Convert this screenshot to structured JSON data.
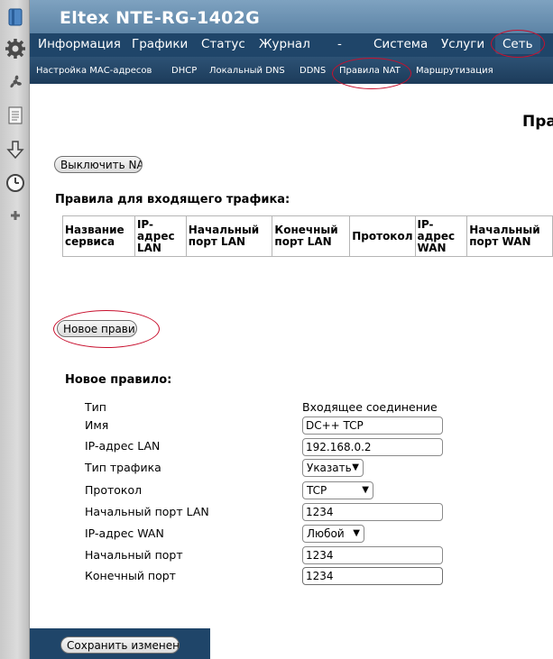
{
  "app": {
    "title": "Eltex NTE-RG-1402G"
  },
  "main_nav": [
    {
      "label": "Информация"
    },
    {
      "label": "Графики"
    },
    {
      "label": "Статус"
    },
    {
      "label": "Журнал"
    },
    {
      "label": "-"
    },
    {
      "label": "Система"
    },
    {
      "label": "Услуги"
    },
    {
      "label": "Сеть",
      "active": true
    }
  ],
  "sub_nav": [
    {
      "label": "Настройка МАС-адресов"
    },
    {
      "label": "DHCP"
    },
    {
      "label": "Локальный DNS"
    },
    {
      "label": "DDNS"
    },
    {
      "label": "Правила NAT",
      "active": true
    },
    {
      "label": "Маршрутизация"
    }
  ],
  "toolbar_icons": [
    "bookmark-icon",
    "gear-icon",
    "fan-icon",
    "notes-icon",
    "download-arrow-icon",
    "clock-icon",
    "plus-icon"
  ],
  "page": {
    "heading": "Пра",
    "disable_nat_button": "Выключить NAT",
    "incoming_title": "Правила для входящего трафика:",
    "table_headers": [
      {
        "label": "Название сервиса"
      },
      {
        "label": "IP-адрес LAN"
      },
      {
        "label": "Начальный порт LAN"
      },
      {
        "label": "Конечный порт LAN"
      },
      {
        "label": "Протокол"
      },
      {
        "label": "IP-адрес WAN"
      },
      {
        "label": "Начальный порт WAN"
      }
    ],
    "new_rule_button": "Новое правило",
    "save_button": "Сохранить изменения"
  },
  "form": {
    "title": "Новое правило:",
    "type_label": "Тип",
    "type_value": "Входящее соединение",
    "name_label": "Имя",
    "name_value": "DC++ TCP",
    "lan_ip_label": "IP-адрес LAN",
    "lan_ip_value": "192.168.0.2",
    "traffic_type_label": "Тип трафика",
    "traffic_type_value": "Указать",
    "protocol_label": "Протокол",
    "protocol_value": "TCP",
    "lan_start_port_label": "Начальный порт LAN",
    "lan_start_port_value": "1234",
    "wan_ip_label": "IP-адрес WAN",
    "wan_ip_value": "Любой",
    "start_port_label": "Начальный порт",
    "start_port_value": "1234",
    "end_port_label": "Конечный порт",
    "end_port_value": "1234"
  },
  "colors": {
    "header_gradient_top": "#7ea2c0",
    "nav_background": "#1f4569",
    "highlight_ellipse": "#c8102e"
  }
}
